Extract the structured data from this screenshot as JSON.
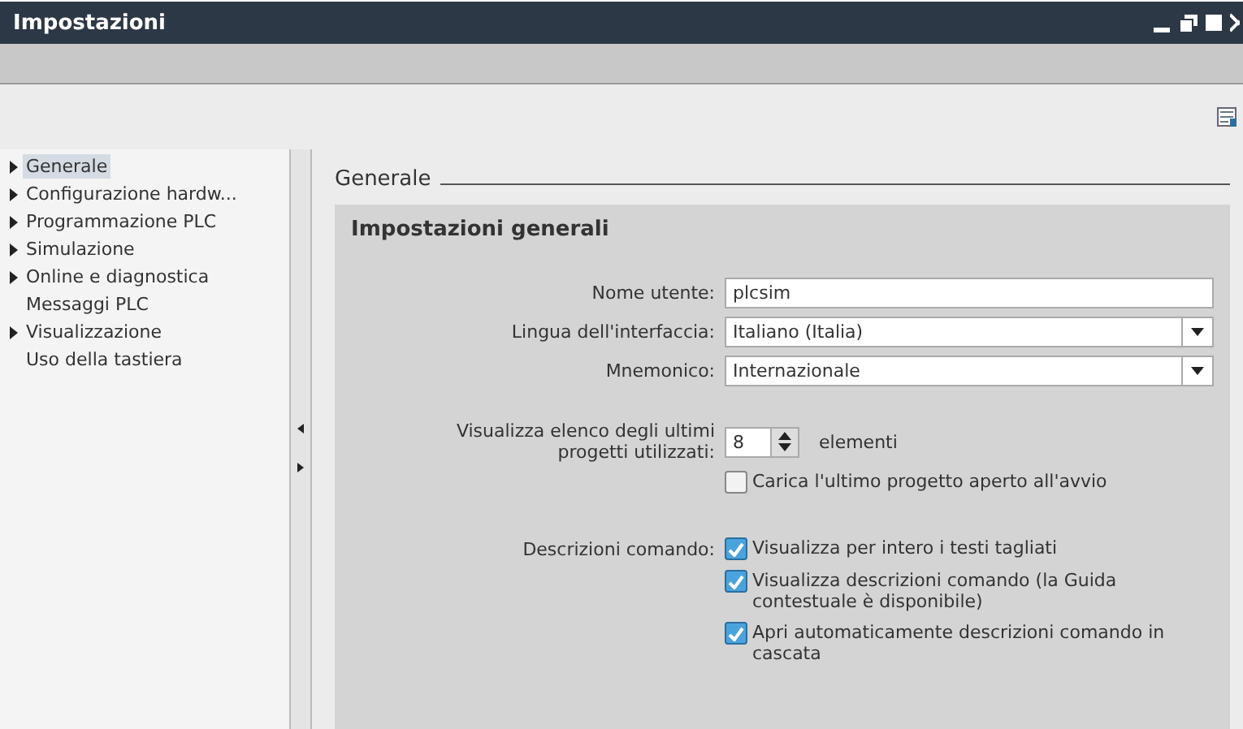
{
  "window": {
    "title": "Impostazioni"
  },
  "sidebar": {
    "items": [
      {
        "label": "Generale",
        "has_children": true,
        "selected": true
      },
      {
        "label": "Configurazione hardw...",
        "has_children": true,
        "selected": false
      },
      {
        "label": "Programmazione PLC",
        "has_children": true,
        "selected": false
      },
      {
        "label": "Simulazione",
        "has_children": true,
        "selected": false
      },
      {
        "label": "Online e diagnostica",
        "has_children": true,
        "selected": false
      },
      {
        "label": "Messaggi PLC",
        "has_children": false,
        "selected": false
      },
      {
        "label": "Visualizzazione",
        "has_children": true,
        "selected": false
      },
      {
        "label": "Uso della tastiera",
        "has_children": false,
        "selected": false
      }
    ]
  },
  "section": {
    "title": "Generale"
  },
  "panel": {
    "title": "Impostazioni generali",
    "fields": [
      {
        "kind": "text",
        "label": "Nome utente:",
        "value": "plcsim"
      },
      {
        "kind": "dropdown",
        "label": "Lingua dell'interfaccia:",
        "value": "Italiano (Italia)"
      },
      {
        "kind": "dropdown",
        "label": "Mnemonico:",
        "value": "Internazionale"
      }
    ],
    "recent": {
      "label": "Visualizza elenco degli ultimi progetti utilizzati:",
      "value": "8",
      "unit": "elementi"
    },
    "load_last": {
      "label": "Carica l'ultimo progetto aperto all'avvio",
      "checked": false
    },
    "tooltips": {
      "label": "Descrizioni comando:",
      "options": [
        {
          "label": "Visualizza per intero i testi tagliati",
          "checked": true
        },
        {
          "label": "Visualizza descrizioni comando (la Guida contestuale è disponibile)",
          "checked": true
        },
        {
          "label": "Apri automaticamente descrizioni comando in cascata",
          "checked": true
        }
      ]
    }
  }
}
